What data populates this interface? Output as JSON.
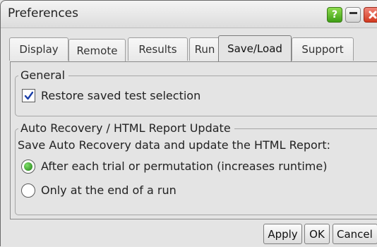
{
  "window": {
    "title": "Preferences",
    "help_label": "?"
  },
  "tabs": [
    {
      "label": "Display",
      "active": false
    },
    {
      "label": "Remote",
      "active": false
    },
    {
      "label": "Results",
      "active": false
    },
    {
      "label": "Run",
      "active": false
    },
    {
      "label": "Save/Load",
      "active": true
    },
    {
      "label": "Support",
      "active": false
    }
  ],
  "general": {
    "legend": "General",
    "restore_label": "Restore saved test selection",
    "restore_checked": true
  },
  "auto_recovery": {
    "legend": "Auto Recovery / HTML Report Update",
    "description": "Save Auto Recovery data and update the HTML Report:",
    "options": [
      {
        "label": "After each trial or permutation (increases runtime)",
        "selected": true
      },
      {
        "label": "Only at the end of a run",
        "selected": false
      }
    ]
  },
  "buttons": {
    "apply": "Apply",
    "ok": "OK",
    "cancel": "Cancel"
  },
  "colors": {
    "accent_green": "#3e9e16",
    "close_red": "#d2391f",
    "checkmark_blue": "#1a3fa8"
  }
}
